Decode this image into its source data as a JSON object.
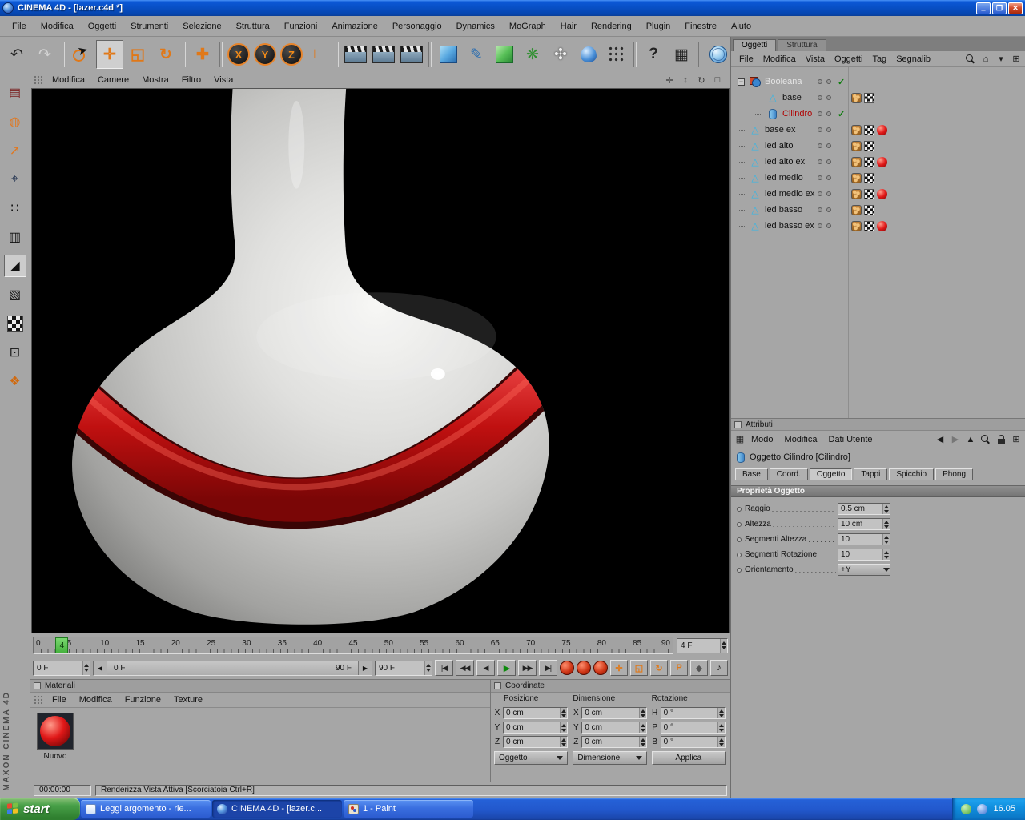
{
  "titlebar": {
    "title": "CINEMA 4D - [lazer.c4d *]"
  },
  "menubar": [
    "File",
    "Modifica",
    "Oggetti",
    "Strumenti",
    "Selezione",
    "Struttura",
    "Funzioni",
    "Animazione",
    "Personaggio",
    "Dynamics",
    "MoGraph",
    "Hair",
    "Rendering",
    "Plugin",
    "Finestre",
    "Aiuto"
  ],
  "toolbar": {
    "axis_locks": [
      "X",
      "Y",
      "Z"
    ]
  },
  "viewport": {
    "menus": [
      "Modifica",
      "Camere",
      "Mostra",
      "Filtro",
      "Vista"
    ]
  },
  "object_manager": {
    "tabs": [
      "Oggetti",
      "Struttura"
    ],
    "menus": [
      "File",
      "Modifica",
      "Vista",
      "Oggetti",
      "Tag",
      "Segnalib"
    ],
    "objects": [
      {
        "name": "Booleana",
        "icon": "boolean",
        "enabled": true,
        "tags": []
      },
      {
        "name": "base",
        "icon": "cone",
        "tags": [
          "phong",
          "texture"
        ]
      },
      {
        "name": "Cilindro",
        "icon": "cylinder",
        "enabled": true,
        "selected": true,
        "tags": []
      },
      {
        "name": "base ex",
        "icon": "cone",
        "tags": [
          "phong",
          "texture",
          "material"
        ]
      },
      {
        "name": "led alto",
        "icon": "cone",
        "tags": [
          "phong",
          "texture"
        ]
      },
      {
        "name": "led alto ex",
        "icon": "cone",
        "tags": [
          "phong",
          "texture",
          "material"
        ]
      },
      {
        "name": "led medio",
        "icon": "cone",
        "tags": [
          "phong",
          "texture"
        ]
      },
      {
        "name": "led medio ex",
        "icon": "cone",
        "tags": [
          "phong",
          "texture",
          "material"
        ]
      },
      {
        "name": "led basso",
        "icon": "cone",
        "tags": [
          "phong",
          "texture"
        ]
      },
      {
        "name": "led basso ex",
        "icon": "cone",
        "tags": [
          "phong",
          "texture",
          "material"
        ]
      }
    ]
  },
  "attributes": {
    "panel_title": "Attributi",
    "menus": [
      "Modo",
      "Modifica",
      "Dati Utente"
    ],
    "object_header": "Oggetto Cilindro [Cilindro]",
    "tabs": [
      "Base",
      "Coord.",
      "Oggetto",
      "Tappi",
      "Spicchio",
      "Phong"
    ],
    "active_tab": "Oggetto",
    "section_title": "Proprietà Oggetto",
    "fields": [
      {
        "label": "Raggio",
        "value": "0.5 cm"
      },
      {
        "label": "Altezza",
        "value": "10 cm"
      },
      {
        "label": "Segmenti Altezza",
        "value": "10"
      },
      {
        "label": "Segmenti Rotazione",
        "value": "10"
      },
      {
        "label": "Orientamento",
        "value": "+Y"
      }
    ]
  },
  "timeline": {
    "ruler_labels": [
      "0",
      "5",
      "10",
      "15",
      "20",
      "25",
      "30",
      "35",
      "40",
      "45",
      "50",
      "55",
      "60",
      "65",
      "70",
      "75",
      "80",
      "85",
      "90"
    ],
    "playhead": "4",
    "current_frame": "4 F",
    "start_frame": "0 F",
    "end_frame": "90 F",
    "range_start": "0 F",
    "range_end": "90 F"
  },
  "materials": {
    "panel_title": "Materiali",
    "menus": [
      "File",
      "Modifica",
      "Funzione",
      "Texture"
    ],
    "items": [
      {
        "name": "Nuovo",
        "color": "#cc1111"
      }
    ]
  },
  "coordinates": {
    "panel_title": "Coordinate",
    "columns": [
      {
        "header": "Posizione",
        "rows": [
          {
            "axis": "X",
            "value": "0 cm"
          },
          {
            "axis": "Y",
            "value": "0 cm"
          },
          {
            "axis": "Z",
            "value": "0 cm"
          }
        ],
        "footer": "Oggetto"
      },
      {
        "header": "Dimensione",
        "rows": [
          {
            "axis": "X",
            "value": "0 cm"
          },
          {
            "axis": "Y",
            "value": "0 cm"
          },
          {
            "axis": "Z",
            "value": "0 cm"
          }
        ],
        "footer": "Dimensione"
      },
      {
        "header": "Rotazione",
        "rows": [
          {
            "axis": "H",
            "value": "0 °"
          },
          {
            "axis": "P",
            "value": "0 °"
          },
          {
            "axis": "B",
            "value": "0 °"
          }
        ],
        "footer": "Applica"
      }
    ]
  },
  "statusbar": {
    "time": "00:00:00",
    "message": "Renderizza Vista Attiva [Scorciatoia Ctrl+R]"
  },
  "taskbar": {
    "start_label": "start",
    "tasks": [
      "Leggi argomento - rie...",
      "CINEMA 4D - [lazer.c...",
      "1 - Paint"
    ],
    "clock": "16.05"
  },
  "branding": "MAXON CINEMA 4D",
  "scene": {
    "description": "White glossy vase with red ring on black background",
    "object_color": "#d6d6d4",
    "ring_color": "#c41414",
    "background": "#000000"
  }
}
